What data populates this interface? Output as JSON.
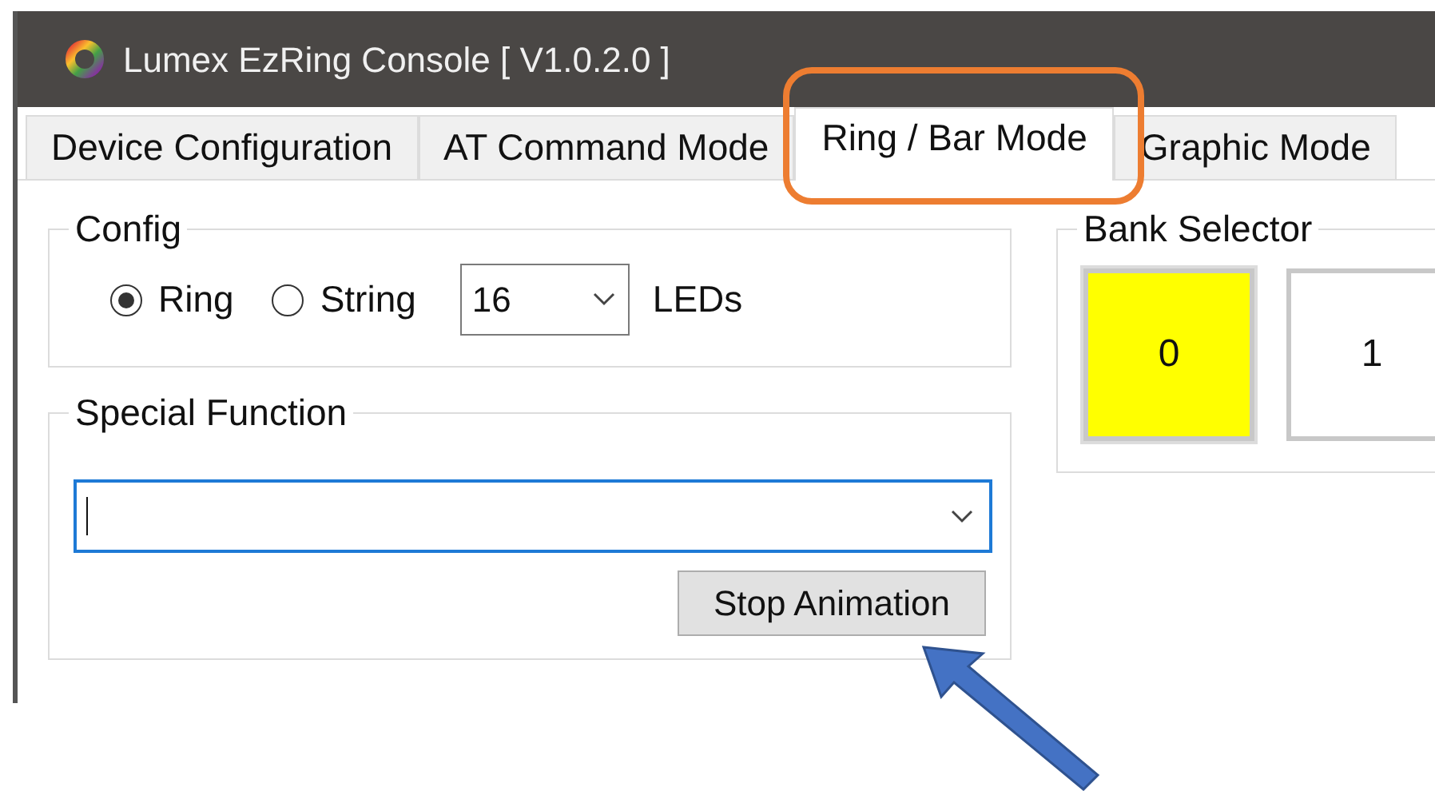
{
  "window": {
    "title": "Lumex EzRing Console [ V1.0.2.0 ]"
  },
  "tabs": [
    {
      "label": "Device Configuration",
      "selected": false
    },
    {
      "label": "AT Command Mode",
      "selected": false
    },
    {
      "label": "Ring / Bar Mode",
      "selected": true
    },
    {
      "label": "Graphic Mode",
      "selected": false
    }
  ],
  "config": {
    "title": "Config",
    "options": [
      {
        "label": "Ring",
        "selected": true
      },
      {
        "label": "String",
        "selected": false
      }
    ],
    "led_count": "16",
    "led_unit": "LEDs"
  },
  "special_function": {
    "title": "Special Function",
    "button": "Stop Animation"
  },
  "bank_selector": {
    "title": "Bank Selector",
    "banks": [
      {
        "label": "0",
        "selected": true
      },
      {
        "label": "1",
        "selected": false
      }
    ]
  }
}
